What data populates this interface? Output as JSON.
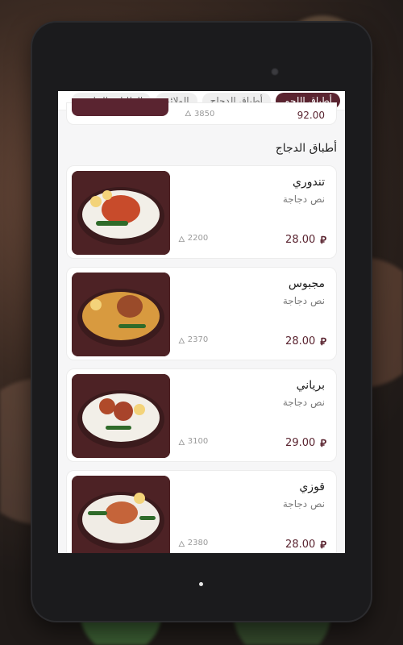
{
  "tabs": [
    "أطباق اللحم",
    "أطباق الدجاج",
    "الولائم",
    "الطلبات الجانبية"
  ],
  "active_tab": 0,
  "top_item": {
    "price": "92.00",
    "calories": "3850"
  },
  "section_title": "أطباق الدجاج",
  "items": [
    {
      "name": "تندوري",
      "description": "نص دجاجة",
      "price": "28.00",
      "calories": "2200"
    },
    {
      "name": "مجبوس",
      "description": "نص دجاجة",
      "price": "28.00",
      "calories": "2370"
    },
    {
      "name": "برياني",
      "description": "نص دجاجة",
      "price": "29.00",
      "calories": "3100"
    },
    {
      "name": "قوزي",
      "description": "نص دجاجة",
      "price": "28.00",
      "calories": "2380"
    }
  ],
  "currency_symbol": "⃁",
  "colors": {
    "accent": "#5a2430",
    "card_bg": "#ffffff",
    "screen_bg": "#f6f6f7"
  }
}
